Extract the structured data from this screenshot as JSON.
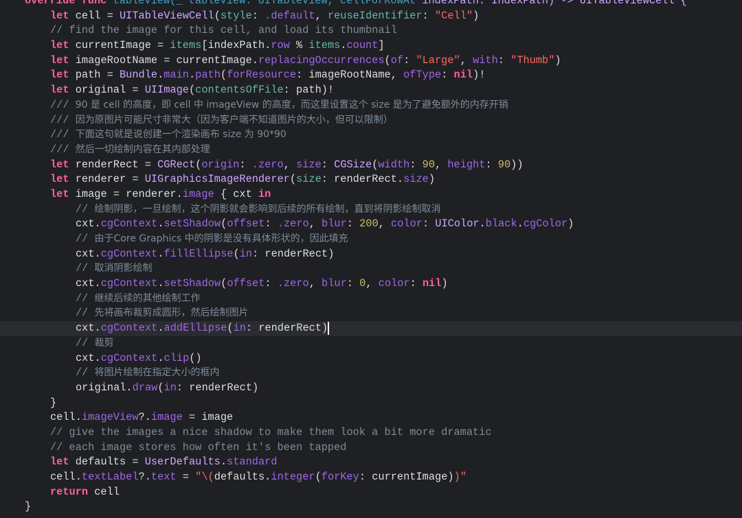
{
  "editor": {
    "language": "swift",
    "theme_colors": {
      "background": "#1f2024",
      "keyword": "#fc5fa3",
      "type": "#d0a8ff",
      "method": "#a167e6",
      "project": "#67b7a4",
      "string": "#fc6a5d",
      "number": "#d0bf69",
      "comment": "#7f8c98",
      "plain": "#dfdfe0"
    },
    "current_line": 22,
    "lines": [
      {
        "indent": 0,
        "tokens": [
          [
            "override func ",
            "k"
          ],
          [
            "tableView(_ tableView: UITableView, cellForRowAt",
            "f"
          ],
          [
            " indexPath: IndexPath) -> UITableViewCell {",
            "t"
          ]
        ]
      },
      {
        "indent": 1,
        "tokens": [
          [
            "let",
            "k"
          ],
          [
            " cell = ",
            "x"
          ],
          [
            "UITableViewCell",
            "t"
          ],
          [
            "(",
            "x"
          ],
          [
            "style",
            "p"
          ],
          [
            ": ",
            "x"
          ],
          [
            ".default",
            "m"
          ],
          [
            ", ",
            "x"
          ],
          [
            "reuseIdentifier",
            "p"
          ],
          [
            ": ",
            "x"
          ],
          [
            "\"Cell\"",
            "s"
          ],
          [
            ")",
            "x"
          ]
        ]
      },
      {
        "indent": 1,
        "tokens": [
          [
            "// find the image for this cell, and load its thumbnail",
            "c"
          ]
        ]
      },
      {
        "indent": 1,
        "tokens": [
          [
            "let",
            "k"
          ],
          [
            " currentImage = ",
            "x"
          ],
          [
            "items",
            "p"
          ],
          [
            "[indexPath.",
            "x"
          ],
          [
            "row",
            "m"
          ],
          [
            " % ",
            "x"
          ],
          [
            "items",
            "p"
          ],
          [
            ".",
            "x"
          ],
          [
            "count",
            "m"
          ],
          [
            "]",
            "x"
          ]
        ]
      },
      {
        "indent": 1,
        "tokens": [
          [
            "let",
            "k"
          ],
          [
            " imageRootName = currentImage.",
            "x"
          ],
          [
            "replacingOccurrences",
            "m"
          ],
          [
            "(",
            "x"
          ],
          [
            "of",
            "m"
          ],
          [
            ": ",
            "x"
          ],
          [
            "\"Large\"",
            "s"
          ],
          [
            ", ",
            "x"
          ],
          [
            "with",
            "m"
          ],
          [
            ": ",
            "x"
          ],
          [
            "\"Thumb\"",
            "s"
          ],
          [
            ")",
            "x"
          ]
        ]
      },
      {
        "indent": 1,
        "tokens": [
          [
            "let",
            "k"
          ],
          [
            " path = ",
            "x"
          ],
          [
            "Bundle",
            "t"
          ],
          [
            ".",
            "x"
          ],
          [
            "main",
            "m"
          ],
          [
            ".",
            "x"
          ],
          [
            "path",
            "m"
          ],
          [
            "(",
            "x"
          ],
          [
            "forResource",
            "m"
          ],
          [
            ": imageRootName, ",
            "x"
          ],
          [
            "ofType",
            "m"
          ],
          [
            ": ",
            "x"
          ],
          [
            "nil",
            "k"
          ],
          [
            ")!",
            "x"
          ]
        ]
      },
      {
        "indent": 1,
        "tokens": [
          [
            "let",
            "k"
          ],
          [
            " original = ",
            "x"
          ],
          [
            "UIImage",
            "t"
          ],
          [
            "(",
            "x"
          ],
          [
            "contentsOfFile",
            "p"
          ],
          [
            ": path)!",
            "x"
          ]
        ]
      },
      {
        "indent": 1,
        "tokens": [
          [
            "/// ",
            "c"
          ],
          [
            "90 是 cell 的高度，即 cell 中 imageView 的高度，而这里设置这个 size 是为了避免额外的内存开销",
            "c cz"
          ]
        ]
      },
      {
        "indent": 1,
        "tokens": [
          [
            "/// ",
            "c"
          ],
          [
            "因为原图片可能尺寸非常大（因为客户端不知道图片的大小，但可以限制）",
            "c cz"
          ]
        ]
      },
      {
        "indent": 1,
        "tokens": [
          [
            "/// ",
            "c"
          ],
          [
            "下面这句就是说创建一个渲染画布 size 为 90*90",
            "c cz"
          ]
        ]
      },
      {
        "indent": 1,
        "tokens": [
          [
            "/// ",
            "c"
          ],
          [
            "然后一切绘制内容在其内部处理",
            "c cz"
          ]
        ]
      },
      {
        "indent": 1,
        "tokens": [
          [
            "let",
            "k"
          ],
          [
            " renderRect = ",
            "x"
          ],
          [
            "CGRect",
            "t"
          ],
          [
            "(",
            "x"
          ],
          [
            "origin",
            "m"
          ],
          [
            ": ",
            "x"
          ],
          [
            ".zero",
            "m"
          ],
          [
            ", ",
            "x"
          ],
          [
            "size",
            "m"
          ],
          [
            ": ",
            "x"
          ],
          [
            "CGSize",
            "t"
          ],
          [
            "(",
            "x"
          ],
          [
            "width",
            "m"
          ],
          [
            ": ",
            "x"
          ],
          [
            "90",
            "n"
          ],
          [
            ", ",
            "x"
          ],
          [
            "height",
            "m"
          ],
          [
            ": ",
            "x"
          ],
          [
            "90",
            "n"
          ],
          [
            "))",
            "x"
          ]
        ]
      },
      {
        "indent": 1,
        "tokens": [
          [
            "let",
            "k"
          ],
          [
            " renderer = ",
            "x"
          ],
          [
            "UIGraphicsImageRenderer",
            "t"
          ],
          [
            "(",
            "x"
          ],
          [
            "size",
            "p"
          ],
          [
            ": renderRect.",
            "x"
          ],
          [
            "size",
            "m"
          ],
          [
            ")",
            "x"
          ]
        ]
      },
      {
        "indent": 1,
        "tokens": [
          [
            "let",
            "k"
          ],
          [
            " image = renderer.",
            "x"
          ],
          [
            "image",
            "m"
          ],
          [
            " { cxt ",
            "x"
          ],
          [
            "in",
            "k"
          ]
        ]
      },
      {
        "indent": 2,
        "tokens": [
          [
            "// ",
            "c"
          ],
          [
            "绘制阴影，一旦绘制，这个阴影就会影响到后续的所有绘制，直到将阴影绘制取消",
            "c cz"
          ]
        ]
      },
      {
        "indent": 2,
        "tokens": [
          [
            "cxt.",
            "x"
          ],
          [
            "cgContext",
            "m"
          ],
          [
            ".",
            "x"
          ],
          [
            "setShadow",
            "m"
          ],
          [
            "(",
            "x"
          ],
          [
            "offset",
            "m"
          ],
          [
            ": ",
            "x"
          ],
          [
            ".zero",
            "m"
          ],
          [
            ", ",
            "x"
          ],
          [
            "blur",
            "m"
          ],
          [
            ": ",
            "x"
          ],
          [
            "200",
            "n"
          ],
          [
            ", ",
            "x"
          ],
          [
            "color",
            "m"
          ],
          [
            ": ",
            "x"
          ],
          [
            "UIColor",
            "t"
          ],
          [
            ".",
            "x"
          ],
          [
            "black",
            "m"
          ],
          [
            ".",
            "x"
          ],
          [
            "cgColor",
            "m"
          ],
          [
            ")",
            "x"
          ]
        ]
      },
      {
        "indent": 2,
        "tokens": [
          [
            "// ",
            "c"
          ],
          [
            "由于Core Graphics 中的阴影是没有具体形状的，因此填充",
            "c cz"
          ]
        ]
      },
      {
        "indent": 2,
        "tokens": [
          [
            "cxt.",
            "x"
          ],
          [
            "cgContext",
            "m"
          ],
          [
            ".",
            "x"
          ],
          [
            "fillEllipse",
            "m"
          ],
          [
            "(",
            "x"
          ],
          [
            "in",
            "m"
          ],
          [
            ": renderRect)",
            "x"
          ]
        ]
      },
      {
        "indent": 2,
        "tokens": [
          [
            "// ",
            "c"
          ],
          [
            "取消阴影绘制",
            "c cz"
          ]
        ]
      },
      {
        "indent": 2,
        "tokens": [
          [
            "cxt.",
            "x"
          ],
          [
            "cgContext",
            "m"
          ],
          [
            ".",
            "x"
          ],
          [
            "setShadow",
            "m"
          ],
          [
            "(",
            "x"
          ],
          [
            "offset",
            "m"
          ],
          [
            ": ",
            "x"
          ],
          [
            ".zero",
            "m"
          ],
          [
            ", ",
            "x"
          ],
          [
            "blur",
            "m"
          ],
          [
            ": ",
            "x"
          ],
          [
            "0",
            "n"
          ],
          [
            ", ",
            "x"
          ],
          [
            "color",
            "m"
          ],
          [
            ": ",
            "x"
          ],
          [
            "nil",
            "k"
          ],
          [
            ")",
            "x"
          ]
        ]
      },
      {
        "indent": 2,
        "tokens": [
          [
            "// ",
            "c"
          ],
          [
            "继续后续的其他绘制工作",
            "c cz"
          ]
        ]
      },
      {
        "indent": 2,
        "tokens": [
          [
            "// ",
            "c"
          ],
          [
            "先将画布裁剪成圆形，然后绘制图片",
            "c cz"
          ]
        ]
      },
      {
        "indent": 2,
        "tokens": [
          [
            "cxt.",
            "x"
          ],
          [
            "cgContext",
            "m"
          ],
          [
            ".",
            "x"
          ],
          [
            "addEllipse",
            "m"
          ],
          [
            "(",
            "x"
          ],
          [
            "in",
            "m"
          ],
          [
            ": renderRect)",
            "x"
          ]
        ]
      },
      {
        "indent": 2,
        "tokens": [
          [
            "// ",
            "c"
          ],
          [
            "裁剪",
            "c cz"
          ]
        ]
      },
      {
        "indent": 2,
        "tokens": [
          [
            "cxt.",
            "x"
          ],
          [
            "cgContext",
            "m"
          ],
          [
            ".",
            "x"
          ],
          [
            "clip",
            "m"
          ],
          [
            "()",
            "x"
          ]
        ]
      },
      {
        "indent": 2,
        "tokens": [
          [
            "// ",
            "c"
          ],
          [
            "将图片绘制在指定大小的框内",
            "c cz"
          ]
        ]
      },
      {
        "indent": 2,
        "tokens": [
          [
            "original.",
            "x"
          ],
          [
            "draw",
            "m"
          ],
          [
            "(",
            "x"
          ],
          [
            "in",
            "m"
          ],
          [
            ": renderRect)",
            "x"
          ]
        ]
      },
      {
        "indent": 1,
        "tokens": [
          [
            "}",
            "x"
          ]
        ]
      },
      {
        "indent": 1,
        "tokens": [
          [
            "cell.",
            "x"
          ],
          [
            "imageView",
            "m"
          ],
          [
            "?.",
            "x"
          ],
          [
            "image",
            "m"
          ],
          [
            " = image",
            "x"
          ]
        ]
      },
      {
        "indent": 1,
        "tokens": [
          [
            "// give the images a nice shadow to make them look a bit more dramatic",
            "c"
          ]
        ]
      },
      {
        "indent": 1,
        "tokens": [
          [
            "// each image stores how often it's been tapped",
            "c"
          ]
        ]
      },
      {
        "indent": 1,
        "tokens": [
          [
            "let",
            "k"
          ],
          [
            " defaults = ",
            "x"
          ],
          [
            "UserDefaults",
            "t"
          ],
          [
            ".",
            "x"
          ],
          [
            "standard",
            "m"
          ]
        ]
      },
      {
        "indent": 1,
        "tokens": [
          [
            "cell.",
            "x"
          ],
          [
            "textLabel",
            "m"
          ],
          [
            "?.",
            "x"
          ],
          [
            "text",
            "m"
          ],
          [
            " = ",
            "x"
          ],
          [
            "\"\\(",
            "s"
          ],
          [
            "defaults.",
            "x"
          ],
          [
            "integer",
            "m"
          ],
          [
            "(",
            "x"
          ],
          [
            "forKey",
            "m"
          ],
          [
            ": currentImage)",
            "x"
          ],
          [
            ")\"",
            "s"
          ]
        ]
      },
      {
        "indent": 1,
        "tokens": [
          [
            "return",
            "k"
          ],
          [
            " cell",
            "x"
          ]
        ]
      },
      {
        "indent": 0,
        "tokens": [
          [
            "}",
            "x"
          ]
        ]
      }
    ]
  }
}
